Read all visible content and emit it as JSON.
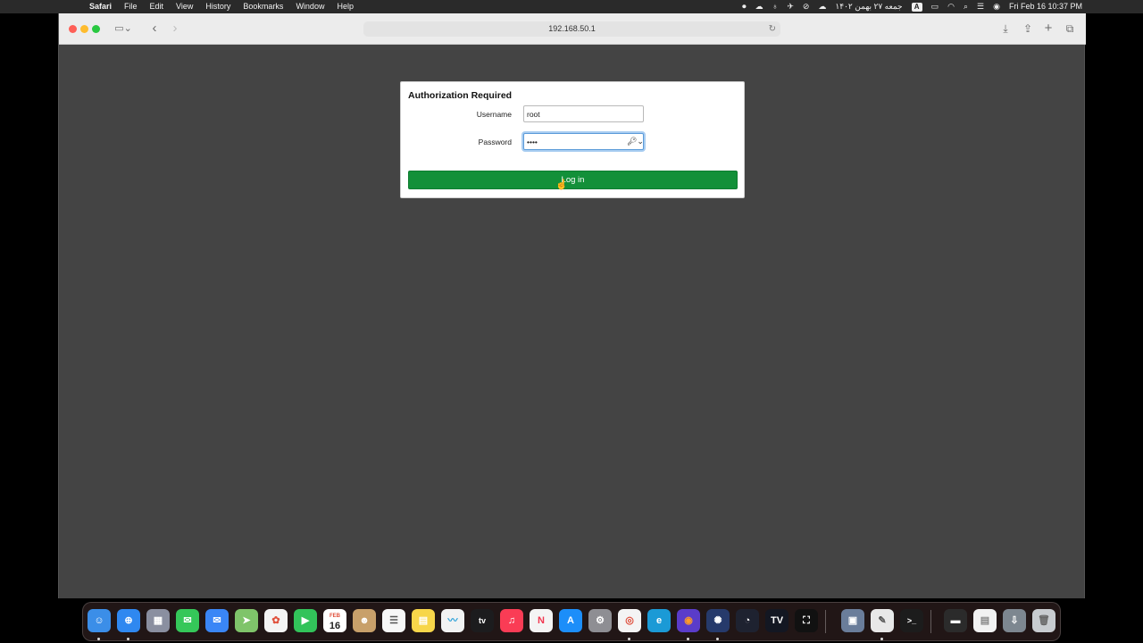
{
  "menubar": {
    "app_name": "Safari",
    "items": [
      "File",
      "Edit",
      "View",
      "History",
      "Bookmarks",
      "Window",
      "Help"
    ],
    "date_persian": "جمعه ۲۷ بهمن ۱۴۰۲",
    "input_badge": "A",
    "clock": "Fri Feb 16  10:37 PM"
  },
  "browser": {
    "url": "192.168.50.1"
  },
  "auth": {
    "title": "Authorization Required",
    "username_label": "Username",
    "username_value": "root",
    "password_label": "Password",
    "password_value": "••••",
    "login_label": "Log in"
  },
  "dock": {
    "calendar_month": "FEB",
    "calendar_day": "16",
    "tv_label": "tv"
  },
  "colors": {
    "login_green": "#139039",
    "page_background": "#444444"
  }
}
